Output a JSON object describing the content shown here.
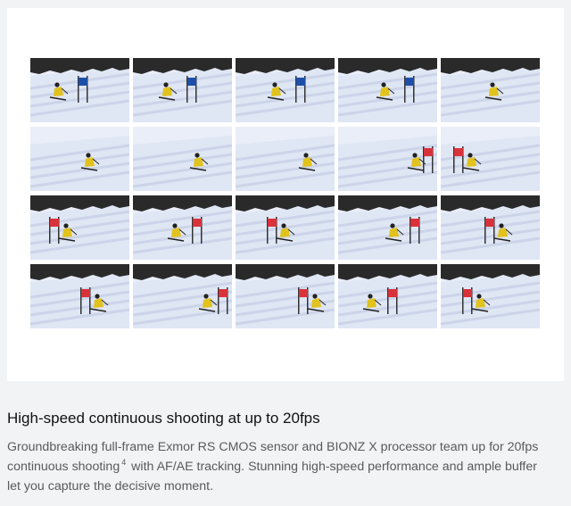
{
  "section": {
    "heading": "High-speed continuous shooting at up to 20fps",
    "description_part1": "Groundbreaking full-frame Exmor RS CMOS sensor and BIONZ X processor team up for 20fps continuous shooting",
    "footnote_marker": "4",
    "description_part2": " with AF/AE tracking. Stunning high-speed performance and ample buffer let you capture the decisive moment."
  },
  "sequence": {
    "rows": 4,
    "columns": 5,
    "frames": [
      {
        "gate": "blue",
        "forest": true
      },
      {
        "gate": "blue",
        "forest": true
      },
      {
        "gate": "blue",
        "forest": true
      },
      {
        "gate": "blue",
        "forest": true
      },
      {
        "gate": "none",
        "forest": true
      },
      {
        "gate": "none",
        "forest": false
      },
      {
        "gate": "none",
        "forest": false
      },
      {
        "gate": "none",
        "forest": false
      },
      {
        "gate": "red",
        "forest": false
      },
      {
        "gate": "red",
        "forest": false
      },
      {
        "gate": "red",
        "forest": true
      },
      {
        "gate": "red",
        "forest": true
      },
      {
        "gate": "red",
        "forest": true
      },
      {
        "gate": "red",
        "forest": true
      },
      {
        "gate": "red",
        "forest": true
      },
      {
        "gate": "red",
        "forest": true
      },
      {
        "gate": "red",
        "forest": true
      },
      {
        "gate": "red",
        "forest": true
      },
      {
        "gate": "red",
        "forest": true
      },
      {
        "gate": "red",
        "forest": true
      }
    ]
  },
  "colors": {
    "page_background": "#f2f3f5",
    "panel_background": "#ffffff",
    "snow": "#e9eef8",
    "snow_shadow": "#c7cfe6",
    "forest": "#2a2a2a",
    "gate_blue": "#1d4fa8",
    "gate_red": "#d8323a",
    "skier_suit": "#e2c21c"
  }
}
